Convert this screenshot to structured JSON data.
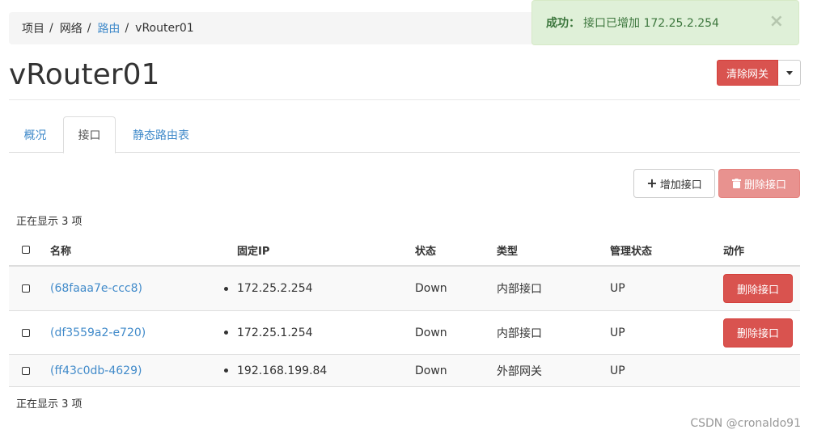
{
  "breadcrumb": {
    "project": "项目",
    "network": "网络",
    "router": "路由",
    "current": "vRouter01",
    "sep": "/"
  },
  "alert": {
    "label": "成功：",
    "message": "接口已增加 172.25.2.254",
    "close": "×"
  },
  "page": {
    "title": "vRouter01",
    "clear_gateway": "清除网关"
  },
  "tabs": {
    "overview": "概况",
    "interfaces": "接口",
    "static_routes": "静态路由表"
  },
  "toolbar": {
    "add_interface": "增加接口",
    "delete_interfaces": "删除接口"
  },
  "table": {
    "count_text": "正在显示 3 项",
    "columns": {
      "name": "名称",
      "fixed_ip": "固定IP",
      "status": "状态",
      "type": "类型",
      "admin_state": "管理状态",
      "actions": "动作"
    },
    "rows": [
      {
        "name": "(68faaa7e-ccc8)",
        "fixed_ip": "172.25.2.254",
        "status": "Down",
        "type": "内部接口",
        "admin_state": "UP",
        "action": "删除接口"
      },
      {
        "name": "(df3559a2-e720)",
        "fixed_ip": "172.25.1.254",
        "status": "Down",
        "type": "内部接口",
        "admin_state": "UP",
        "action": "删除接口"
      },
      {
        "name": "(ff43c0db-4629)",
        "fixed_ip": "192.168.199.84",
        "status": "Down",
        "type": "外部网关",
        "admin_state": "UP",
        "action": ""
      }
    ]
  },
  "watermark": "CSDN @cronaldo91",
  "colors": {
    "link": "#428bca",
    "danger": "#d9534f",
    "success_bg": "#dff0d8",
    "success_text": "#3c763d"
  }
}
